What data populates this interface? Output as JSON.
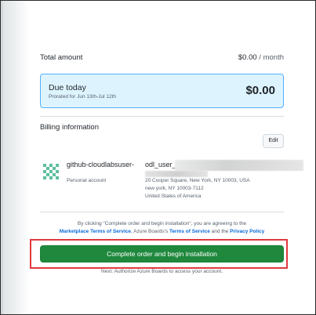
{
  "summary": {
    "total_label": "Total amount",
    "total_amount": "$0.00",
    "total_period": " / month"
  },
  "due": {
    "title": "Due today",
    "prorated": "Prorated for Jun 13th-Jul 12th",
    "amount": "$0.00"
  },
  "billing": {
    "title": "Billing information",
    "edit_label": "Edit",
    "account_name": "github-cloudlabsuser-",
    "account_type": "Personal account",
    "address_name": "odl_user_1",
    "address_lines": [
      "20 Cooper Square, New York, NY 10003, USA",
      "new york, NY 10003-7112",
      "United States of America"
    ]
  },
  "terms": {
    "prefix": "By clicking \"Complete order and begin installation\", you are agreeing to the",
    "marketplace_link": "Marketplace Terms of Service",
    "middle": ", Azure Boards's",
    "tos_link": "Terms of Service",
    "and": "and the",
    "privacy_link": "Privacy Policy"
  },
  "cta": {
    "label": "Complete order and begin installation"
  },
  "next_note": "Next: Authorize Azure Boards to access your account.",
  "colors": {
    "cta_green": "#1f883d",
    "due_bg": "#ddf4ff",
    "due_border": "#54aeff",
    "link_blue": "#0969da",
    "highlight_red": "#e0393e"
  }
}
